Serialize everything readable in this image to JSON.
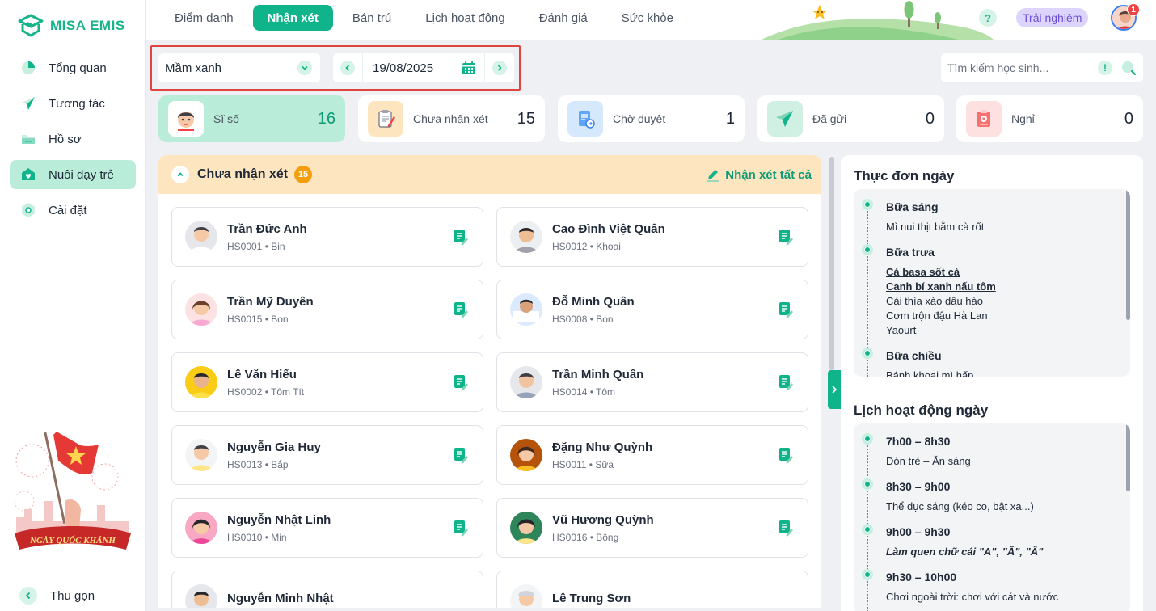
{
  "app": {
    "name": "MISA EMIS"
  },
  "sidebar": {
    "items": [
      {
        "label": "Tổng quan",
        "icon": "pie-chart-icon"
      },
      {
        "label": "Tương tác",
        "icon": "paper-plane-icon"
      },
      {
        "label": "Hồ sơ",
        "icon": "folder-icon"
      },
      {
        "label": "Nuôi dạy trẻ",
        "icon": "heart-house-icon",
        "active": true
      },
      {
        "label": "Cài đặt",
        "icon": "gear-icon"
      }
    ],
    "promo": "NGÀY QUỐC KHÁNH",
    "collapse_label": "Thu gọn"
  },
  "topbar": {
    "tabs": [
      {
        "label": "Điểm danh"
      },
      {
        "label": "Nhận xét",
        "active": true
      },
      {
        "label": "Bán trú"
      },
      {
        "label": "Lịch hoạt động"
      },
      {
        "label": "Đánh giá"
      },
      {
        "label": "Sức khỏe"
      }
    ],
    "help": "?",
    "trial": "Trải nghiệm",
    "notifications": "1"
  },
  "filters": {
    "class": "Mầm xanh",
    "date": "19/08/2025",
    "search_placeholder": "Tìm kiếm học sinh...",
    "search_warn": "!"
  },
  "stats": [
    {
      "label": "Sĩ số",
      "value": "16",
      "icon": "student-face-icon",
      "active": true
    },
    {
      "label": "Chưa nhận xét",
      "value": "15",
      "icon": "clipboard-pen-icon"
    },
    {
      "label": "Chờ duyệt",
      "value": "1",
      "icon": "document-pending-icon"
    },
    {
      "label": "Đã gửi",
      "value": "0",
      "icon": "paper-plane-icon"
    },
    {
      "label": "Nghỉ",
      "value": "0",
      "icon": "clipboard-x-icon"
    }
  ],
  "comments": {
    "title": "Chưa nhận xét",
    "count": "15",
    "action": "Nhận xét tất cả",
    "students": [
      {
        "name": "Trần Đức Anh",
        "code": "HS0001 • Bin"
      },
      {
        "name": "Cao Đình Việt Quân",
        "code": "HS0012 • Khoai"
      },
      {
        "name": "Trần Mỹ Duyên",
        "code": "HS0015 • Bon"
      },
      {
        "name": "Đỗ Minh Quân",
        "code": "HS0008 • Bon"
      },
      {
        "name": "Lê Văn Hiếu",
        "code": "HS0002 • Tôm Tít"
      },
      {
        "name": "Trần Minh Quân",
        "code": "HS0014 • Tôm"
      },
      {
        "name": "Nguyễn Gia Huy",
        "code": "HS0013 • Bắp"
      },
      {
        "name": "Đặng Như Quỳnh",
        "code": "HS0011 • Sữa"
      },
      {
        "name": "Nguyễn Nhật Linh",
        "code": "HS0010 • Min"
      },
      {
        "name": "Vũ Hương Quỳnh",
        "code": "HS0016 • Bông"
      },
      {
        "name": "Nguyễn Minh Nhật",
        "code": ""
      },
      {
        "name": "Lê Trung Sơn",
        "code": ""
      }
    ]
  },
  "menu": {
    "title": "Thực đơn ngày",
    "meals": [
      {
        "title": "Bữa sáng",
        "items": [
          "Mì nui thịt bằm cà rốt"
        ]
      },
      {
        "title": "Bữa trưa",
        "items": [
          "Cá basa sốt cà",
          "Canh bí xanh nấu tôm",
          "Cải thìa xào dầu hào",
          "Cơm trộn đậu Hà Lan",
          "Yaourt"
        ]
      },
      {
        "title": "Bữa chiều",
        "items": [
          "Bánh khoai mì hấp"
        ]
      }
    ]
  },
  "schedule": {
    "title": "Lịch hoạt động ngày",
    "items": [
      {
        "time": "7h00 – 8h30",
        "desc": "Đón trẻ – Ăn sáng"
      },
      {
        "time": "8h30 – 9h00",
        "desc": "Thể dục sáng (kéo co, bật xa...)"
      },
      {
        "time": "9h00 – 9h30",
        "desc": "Làm quen chữ cái \"A\", \"Ă\", \"Â\""
      },
      {
        "time": "9h30 – 10h00",
        "desc": "Chơi ngoài trời: chơi với cát và nước"
      }
    ]
  },
  "colors": {
    "accent": "#0fb48a",
    "accent_light": "#b9ecd9",
    "warning": "#f59e0b",
    "highlight_border": "#e0443e"
  }
}
